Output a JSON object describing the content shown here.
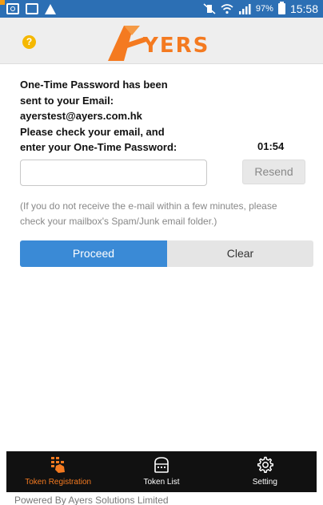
{
  "status_bar": {
    "battery_percent": "97%",
    "time": "15:58"
  },
  "header": {
    "help_icon": "question-mark-icon",
    "logo_text": "YERS",
    "accent_color": "#f47a20"
  },
  "otp": {
    "message_lines": [
      "One-Time Password has been",
      "sent to your Email:",
      "ayerstest@ayers.com.hk",
      "Please check your email, and",
      "enter your One-Time Password:"
    ],
    "countdown": "01:54",
    "input_value": "",
    "input_placeholder": "",
    "resend_label": "Resend",
    "note_line1": "(If you do not receive the e-mail within a few minutes, please",
    "note_line2": "check your mailbox's Spam/Junk email folder.)",
    "proceed_label": "Proceed",
    "clear_label": "Clear"
  },
  "bottom_nav": {
    "items": [
      {
        "label": "Token Registration",
        "icon": "keypad-hand-icon",
        "active": true
      },
      {
        "label": "Token List",
        "icon": "token-device-icon",
        "active": false
      },
      {
        "label": "Setting",
        "icon": "gear-icon",
        "active": false
      }
    ]
  },
  "footer": {
    "text": "Powered By Ayers Solutions Limited"
  }
}
